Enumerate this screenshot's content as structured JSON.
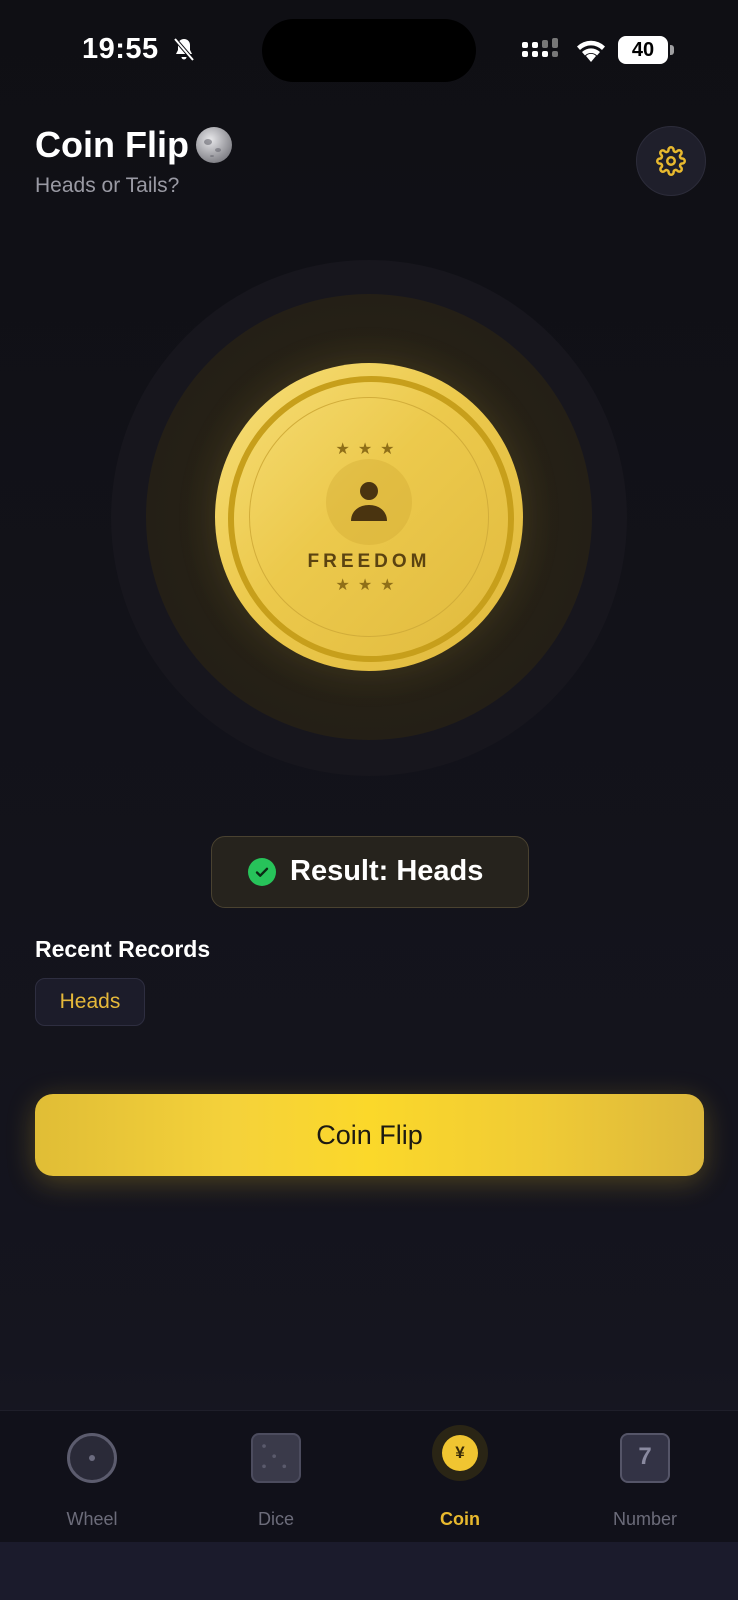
{
  "status_bar": {
    "time": "19:55",
    "battery": "40",
    "icons": [
      "bell-slash-icon",
      "signal-icon",
      "wifi-icon",
      "battery-icon"
    ]
  },
  "header": {
    "title": "Coin Flip",
    "title_icon": "moon-emoji-icon",
    "subtitle": "Heads or Tails?",
    "settings_icon": "gear-icon"
  },
  "coin": {
    "stars_top": "★★★",
    "stars_bottom": "★★★",
    "word": "FREEDOM",
    "face_icon": "person-icon"
  },
  "result": {
    "text": "Result: Heads",
    "icon": "check-circle-icon"
  },
  "records": {
    "title": "Recent Records",
    "items": [
      "Heads"
    ]
  },
  "action": {
    "label": "Coin Flip"
  },
  "tabs": [
    {
      "label": "Wheel",
      "icon": "wheel-icon",
      "active": false
    },
    {
      "label": "Dice",
      "icon": "dice-icon",
      "active": false
    },
    {
      "label": "Coin",
      "icon": "coin-icon",
      "icon_text": "¥",
      "active": true
    },
    {
      "label": "Number",
      "icon": "number-icon",
      "icon_text": "7",
      "active": false
    }
  ],
  "colors": {
    "accent": "#e8b92e",
    "background": "#121219",
    "success": "#27c35a"
  }
}
